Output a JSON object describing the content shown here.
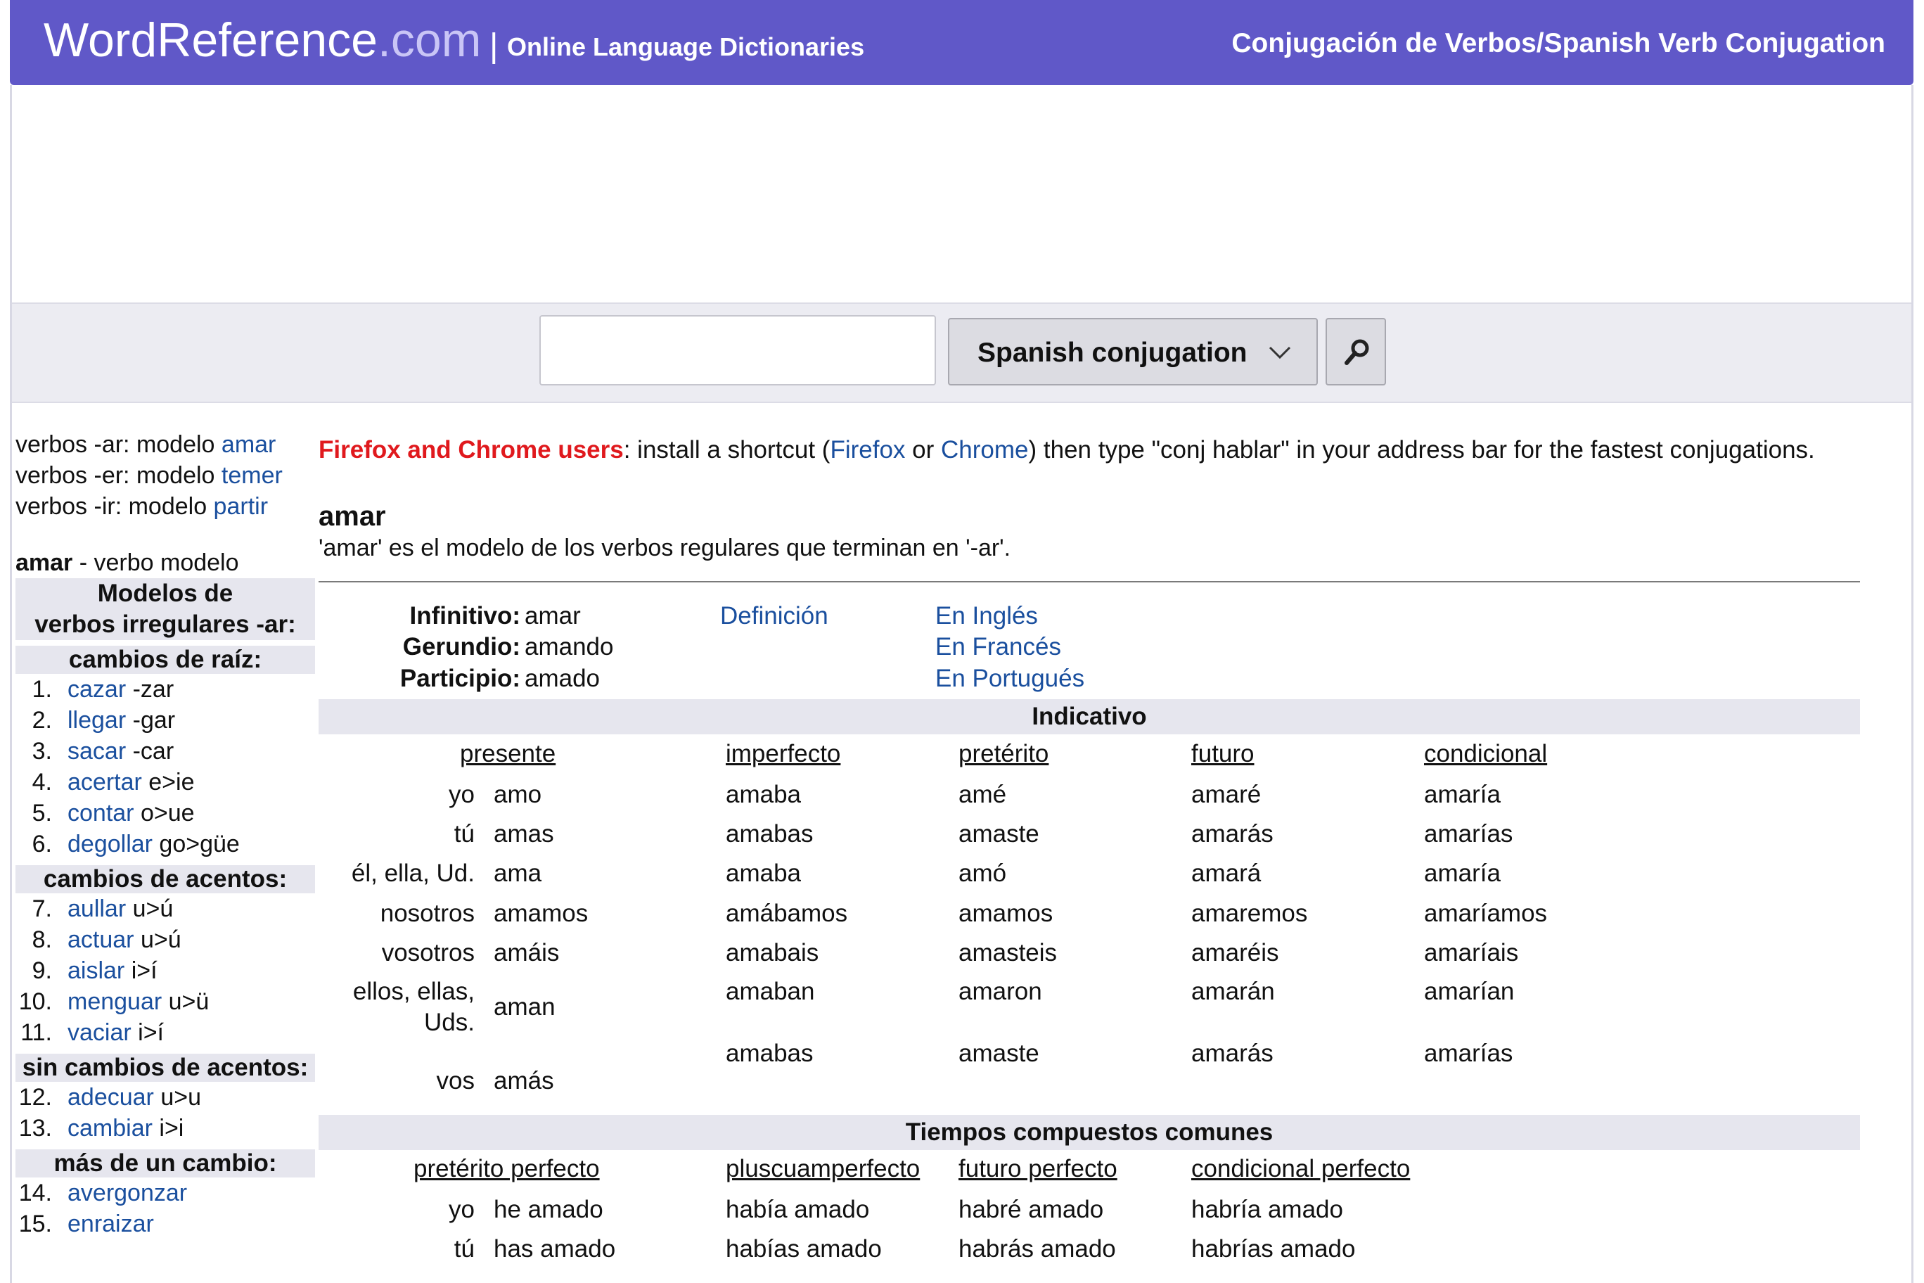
{
  "header": {
    "logo_main": "WordReference",
    "logo_domain": ".com",
    "separator": "|",
    "tagline": "Online Language Dictionaries",
    "title": "Conjugación de Verbos/Spanish Verb Conjugation"
  },
  "search": {
    "input_value": "",
    "dictionary_selected": "Spanish conjugation"
  },
  "sidebar": {
    "models": [
      {
        "prefix": "verbos -ar: modelo ",
        "link": "amar"
      },
      {
        "prefix": "verbos -er: modelo ",
        "link": "temer"
      },
      {
        "prefix": "verbos -ir: modelo ",
        "link": "partir"
      }
    ],
    "current_verb": "amar",
    "current_verb_note": " - verbo modelo",
    "heading_models_1": "Modelos de",
    "heading_models_2": "verbos irregulares -ar:",
    "sections": [
      {
        "heading": "cambios de raíz:",
        "items": [
          {
            "num": "1.",
            "verb": "cazar",
            "note": " -zar"
          },
          {
            "num": "2.",
            "verb": "llegar",
            "note": " -gar"
          },
          {
            "num": "3.",
            "verb": "sacar",
            "note": " -car"
          },
          {
            "num": "4.",
            "verb": "acertar",
            "note": " e>ie"
          },
          {
            "num": "5.",
            "verb": "contar",
            "note": " o>ue"
          },
          {
            "num": "6.",
            "verb": "degollar",
            "note": " go>güe"
          }
        ]
      },
      {
        "heading": "cambios de acentos:",
        "items": [
          {
            "num": "7.",
            "verb": "aullar",
            "note": " u>ú"
          },
          {
            "num": "8.",
            "verb": "actuar",
            "note": " u>ú"
          },
          {
            "num": "9.",
            "verb": "aislar",
            "note": " i>í"
          },
          {
            "num": "10.",
            "verb": "menguar",
            "note": " u>ü"
          },
          {
            "num": "11.",
            "verb": "vaciar",
            "note": " i>í"
          }
        ]
      },
      {
        "heading": "sin cambios de acentos:",
        "items": [
          {
            "num": "12.",
            "verb": "adecuar",
            "note": " u>u"
          },
          {
            "num": "13.",
            "verb": "cambiar",
            "note": " i>i"
          }
        ]
      },
      {
        "heading": "más de un cambio:",
        "items": [
          {
            "num": "14.",
            "verb": "avergonzar",
            "note": ""
          },
          {
            "num": "15.",
            "verb": "enraizar",
            "note": ""
          }
        ]
      }
    ]
  },
  "promo": {
    "highlight": "Firefox and Chrome users",
    "text1": ": install a shortcut (",
    "firefox": "Firefox",
    "or": " or ",
    "chrome": "Chrome",
    "text2": ") then type \"conj hablar\" in your address bar for the fastest conjugations."
  },
  "verb": {
    "title": "amar",
    "description": "'amar' es el modelo de los verbos regulares que terminan en '-ar'.",
    "infinitivo_label": "Infinitivo:",
    "infinitivo": "amar",
    "gerundio_label": "Gerundio:",
    "gerundio": "amando",
    "participio_label": "Participio:",
    "participio": "amado",
    "definicion": "Definición",
    "en_ingles": "En Inglés",
    "en_frances": "En Francés",
    "en_portugues": "En Portugués"
  },
  "indicativo": {
    "band": "Indicativo",
    "columns": [
      "presente",
      "imperfecto",
      "pretérito",
      "futuro",
      "condicional"
    ],
    "pronouns": [
      "yo",
      "tú",
      "él, ella, Ud.",
      "nosotros",
      "vosotros",
      "ellos, ellas,",
      "Uds.",
      "vos"
    ],
    "presente": [
      "amo",
      "amas",
      "ama",
      "amamos",
      "amáis",
      "aman",
      "amás"
    ],
    "imperfecto": [
      "amaba",
      "amabas",
      "amaba",
      "amábamos",
      "amabais",
      "amaban",
      "amabas"
    ],
    "preterito": [
      "amé",
      "amaste",
      "amó",
      "amamos",
      "amasteis",
      "amaron",
      "amaste"
    ],
    "futuro": [
      "amaré",
      "amarás",
      "amará",
      "amaremos",
      "amaréis",
      "amarán",
      "amarás"
    ],
    "condicional": [
      "amaría",
      "amarías",
      "amaría",
      "amaríamos",
      "amaríais",
      "amarían",
      "amarías"
    ]
  },
  "compuestos": {
    "band": "Tiempos compuestos comunes",
    "columns": [
      "pretérito perfecto",
      "pluscuamperfecto",
      "futuro perfecto",
      "condicional perfecto"
    ],
    "pronouns": [
      "yo",
      "tú"
    ],
    "preterito_perfecto": [
      "he amado",
      "has amado"
    ],
    "pluscuamperfecto": [
      "había amado",
      "habías amado"
    ],
    "futuro_perfecto": [
      "habré amado",
      "habrás amado"
    ],
    "condicional_perfecto": [
      "habría amado",
      "habrías amado"
    ]
  }
}
